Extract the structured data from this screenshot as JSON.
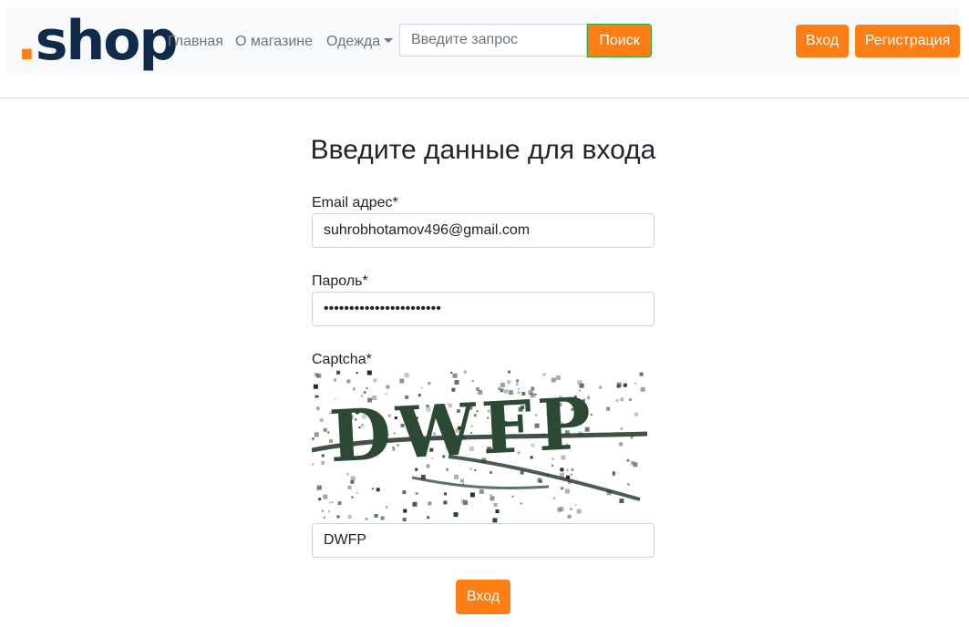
{
  "navbar": {
    "logo": {
      "dot": ".",
      "text": "shop"
    },
    "links": [
      {
        "label": "Главная"
      },
      {
        "label": "О магазине"
      },
      {
        "label": "Одежда"
      }
    ],
    "search": {
      "placeholder": "Введите запрос",
      "button_label": "Поиск"
    },
    "login_label": "Вход",
    "register_label": "Регистрация"
  },
  "form": {
    "title": "Введите данные для входа",
    "email": {
      "label": "Email адрес*",
      "value": "suhrobhotamov496@gmail.com"
    },
    "password": {
      "label": "Пароль*",
      "value": "suhrobhotamov496pass123"
    },
    "captcha": {
      "label": "Captcha*",
      "image_text": "DWFP",
      "value": "DWFP"
    },
    "submit_label": "Вход"
  },
  "colors": {
    "accent": "#fd7e14",
    "logo_text": "#0f2a4a",
    "navbar_bg": "#f8f9fa",
    "nav_link": "#6c757d"
  }
}
